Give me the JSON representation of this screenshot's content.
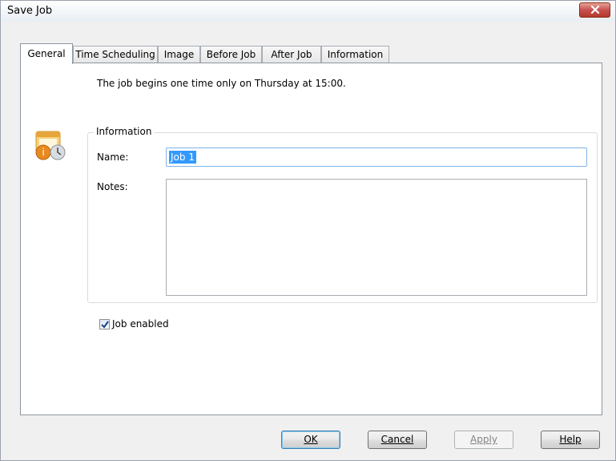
{
  "window": {
    "title": "Save Job"
  },
  "tabs": [
    {
      "label": "General",
      "active": true
    },
    {
      "label": "Time Scheduling",
      "active": false
    },
    {
      "label": "Image",
      "active": false
    },
    {
      "label": "Before Job",
      "active": false
    },
    {
      "label": "After Job",
      "active": false
    },
    {
      "label": "Information",
      "active": false
    }
  ],
  "general": {
    "summary": "The job begins one time only on Thursday at 15:00.",
    "icon": "calendar-info-icon",
    "information_group": {
      "legend": "Information",
      "name_label": "Name:",
      "name_value": "Job 1",
      "notes_label": "Notes:",
      "notes_value": ""
    },
    "job_enabled": {
      "label": "Job enabled",
      "checked": true
    }
  },
  "buttons": {
    "ok": "OK",
    "cancel": "Cancel",
    "apply": "Apply",
    "help": "Help"
  },
  "colors": {
    "selection": "#3399ff",
    "close_button": "#c75050",
    "focus_border": "#7eb4ea"
  }
}
